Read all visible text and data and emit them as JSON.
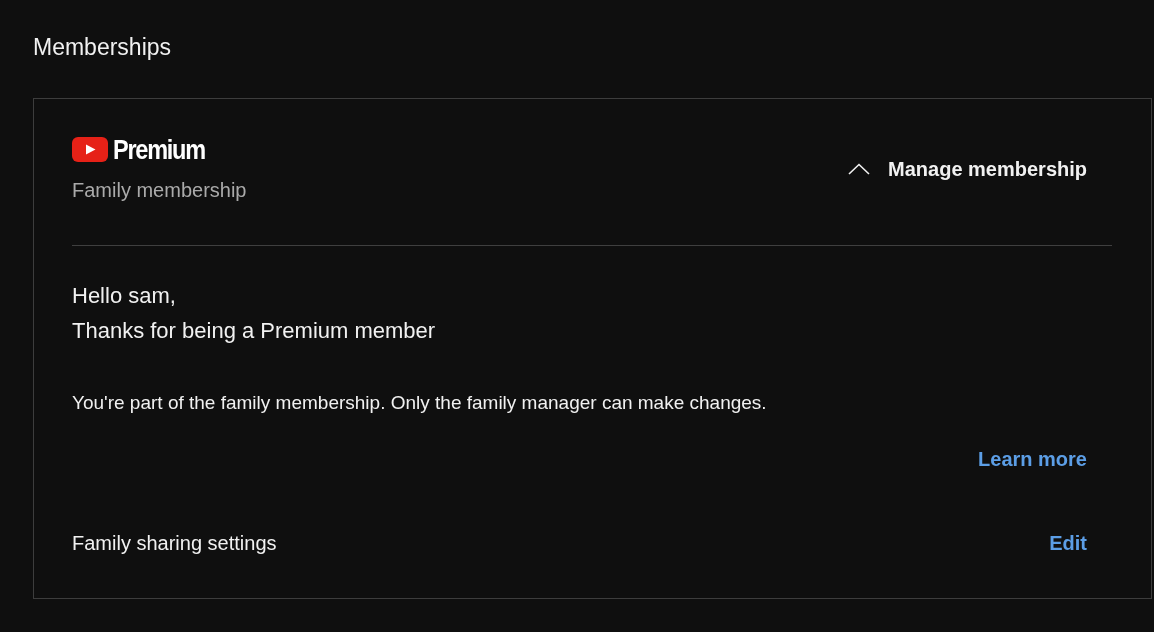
{
  "page": {
    "title": "Memberships"
  },
  "membership_card": {
    "logo_text": "Premium",
    "plan": "Family membership",
    "manage_button": {
      "label": "Manage membership",
      "expanded": true
    },
    "greeting": [
      "Hello sam,",
      "Thanks for being a Premium member"
    ],
    "notice": "You're part of the family membership. Only the family manager can make changes.",
    "learn_more_link": "Learn more",
    "settings": [
      {
        "label": "Family sharing settings",
        "action": "Edit"
      }
    ]
  }
}
